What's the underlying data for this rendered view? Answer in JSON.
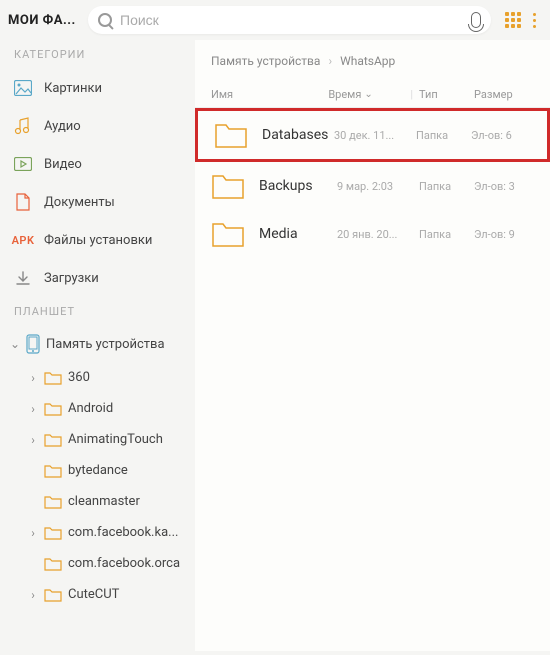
{
  "header": {
    "title": "МОИ ФА...",
    "search_placeholder": "Поиск"
  },
  "sidebar": {
    "section_categories": "КАТЕГОРИИ",
    "categories": [
      {
        "label": "Картинки",
        "icon": "image"
      },
      {
        "label": "Аудио",
        "icon": "audio"
      },
      {
        "label": "Видео",
        "icon": "video"
      },
      {
        "label": "Документы",
        "icon": "document"
      },
      {
        "label": "Файлы установки",
        "icon": "apk"
      },
      {
        "label": "Загрузки",
        "icon": "download"
      }
    ],
    "section_device": "ПЛАНШЕТ",
    "device_label": "Память устройства",
    "folders": [
      {
        "label": "360",
        "chevron": true
      },
      {
        "label": "Android",
        "chevron": true
      },
      {
        "label": "AnimatingTouch",
        "chevron": true
      },
      {
        "label": "bytedance",
        "chevron": false
      },
      {
        "label": "cleanmaster",
        "chevron": false
      },
      {
        "label": "com.facebook.ka...",
        "chevron": true
      },
      {
        "label": "com.facebook.orca",
        "chevron": false
      },
      {
        "label": "CuteCUT",
        "chevron": true
      }
    ]
  },
  "content": {
    "breadcrumb": [
      "Память устройства",
      "WhatsApp"
    ],
    "columns": {
      "name": "Имя",
      "time": "Время",
      "type": "Тип",
      "size": "Размер"
    },
    "rows": [
      {
        "name": "Databases",
        "time": "30 дек. 11...",
        "type": "Папка",
        "size": "Эл-ов: 6",
        "highlight": true
      },
      {
        "name": "Backups",
        "time": "9 мар. 2:03",
        "type": "Папка",
        "size": "Эл-ов: 3",
        "highlight": false
      },
      {
        "name": "Media",
        "time": "20 янв. 20...",
        "type": "Папка",
        "size": "Эл-ов: 9",
        "highlight": false
      }
    ]
  }
}
